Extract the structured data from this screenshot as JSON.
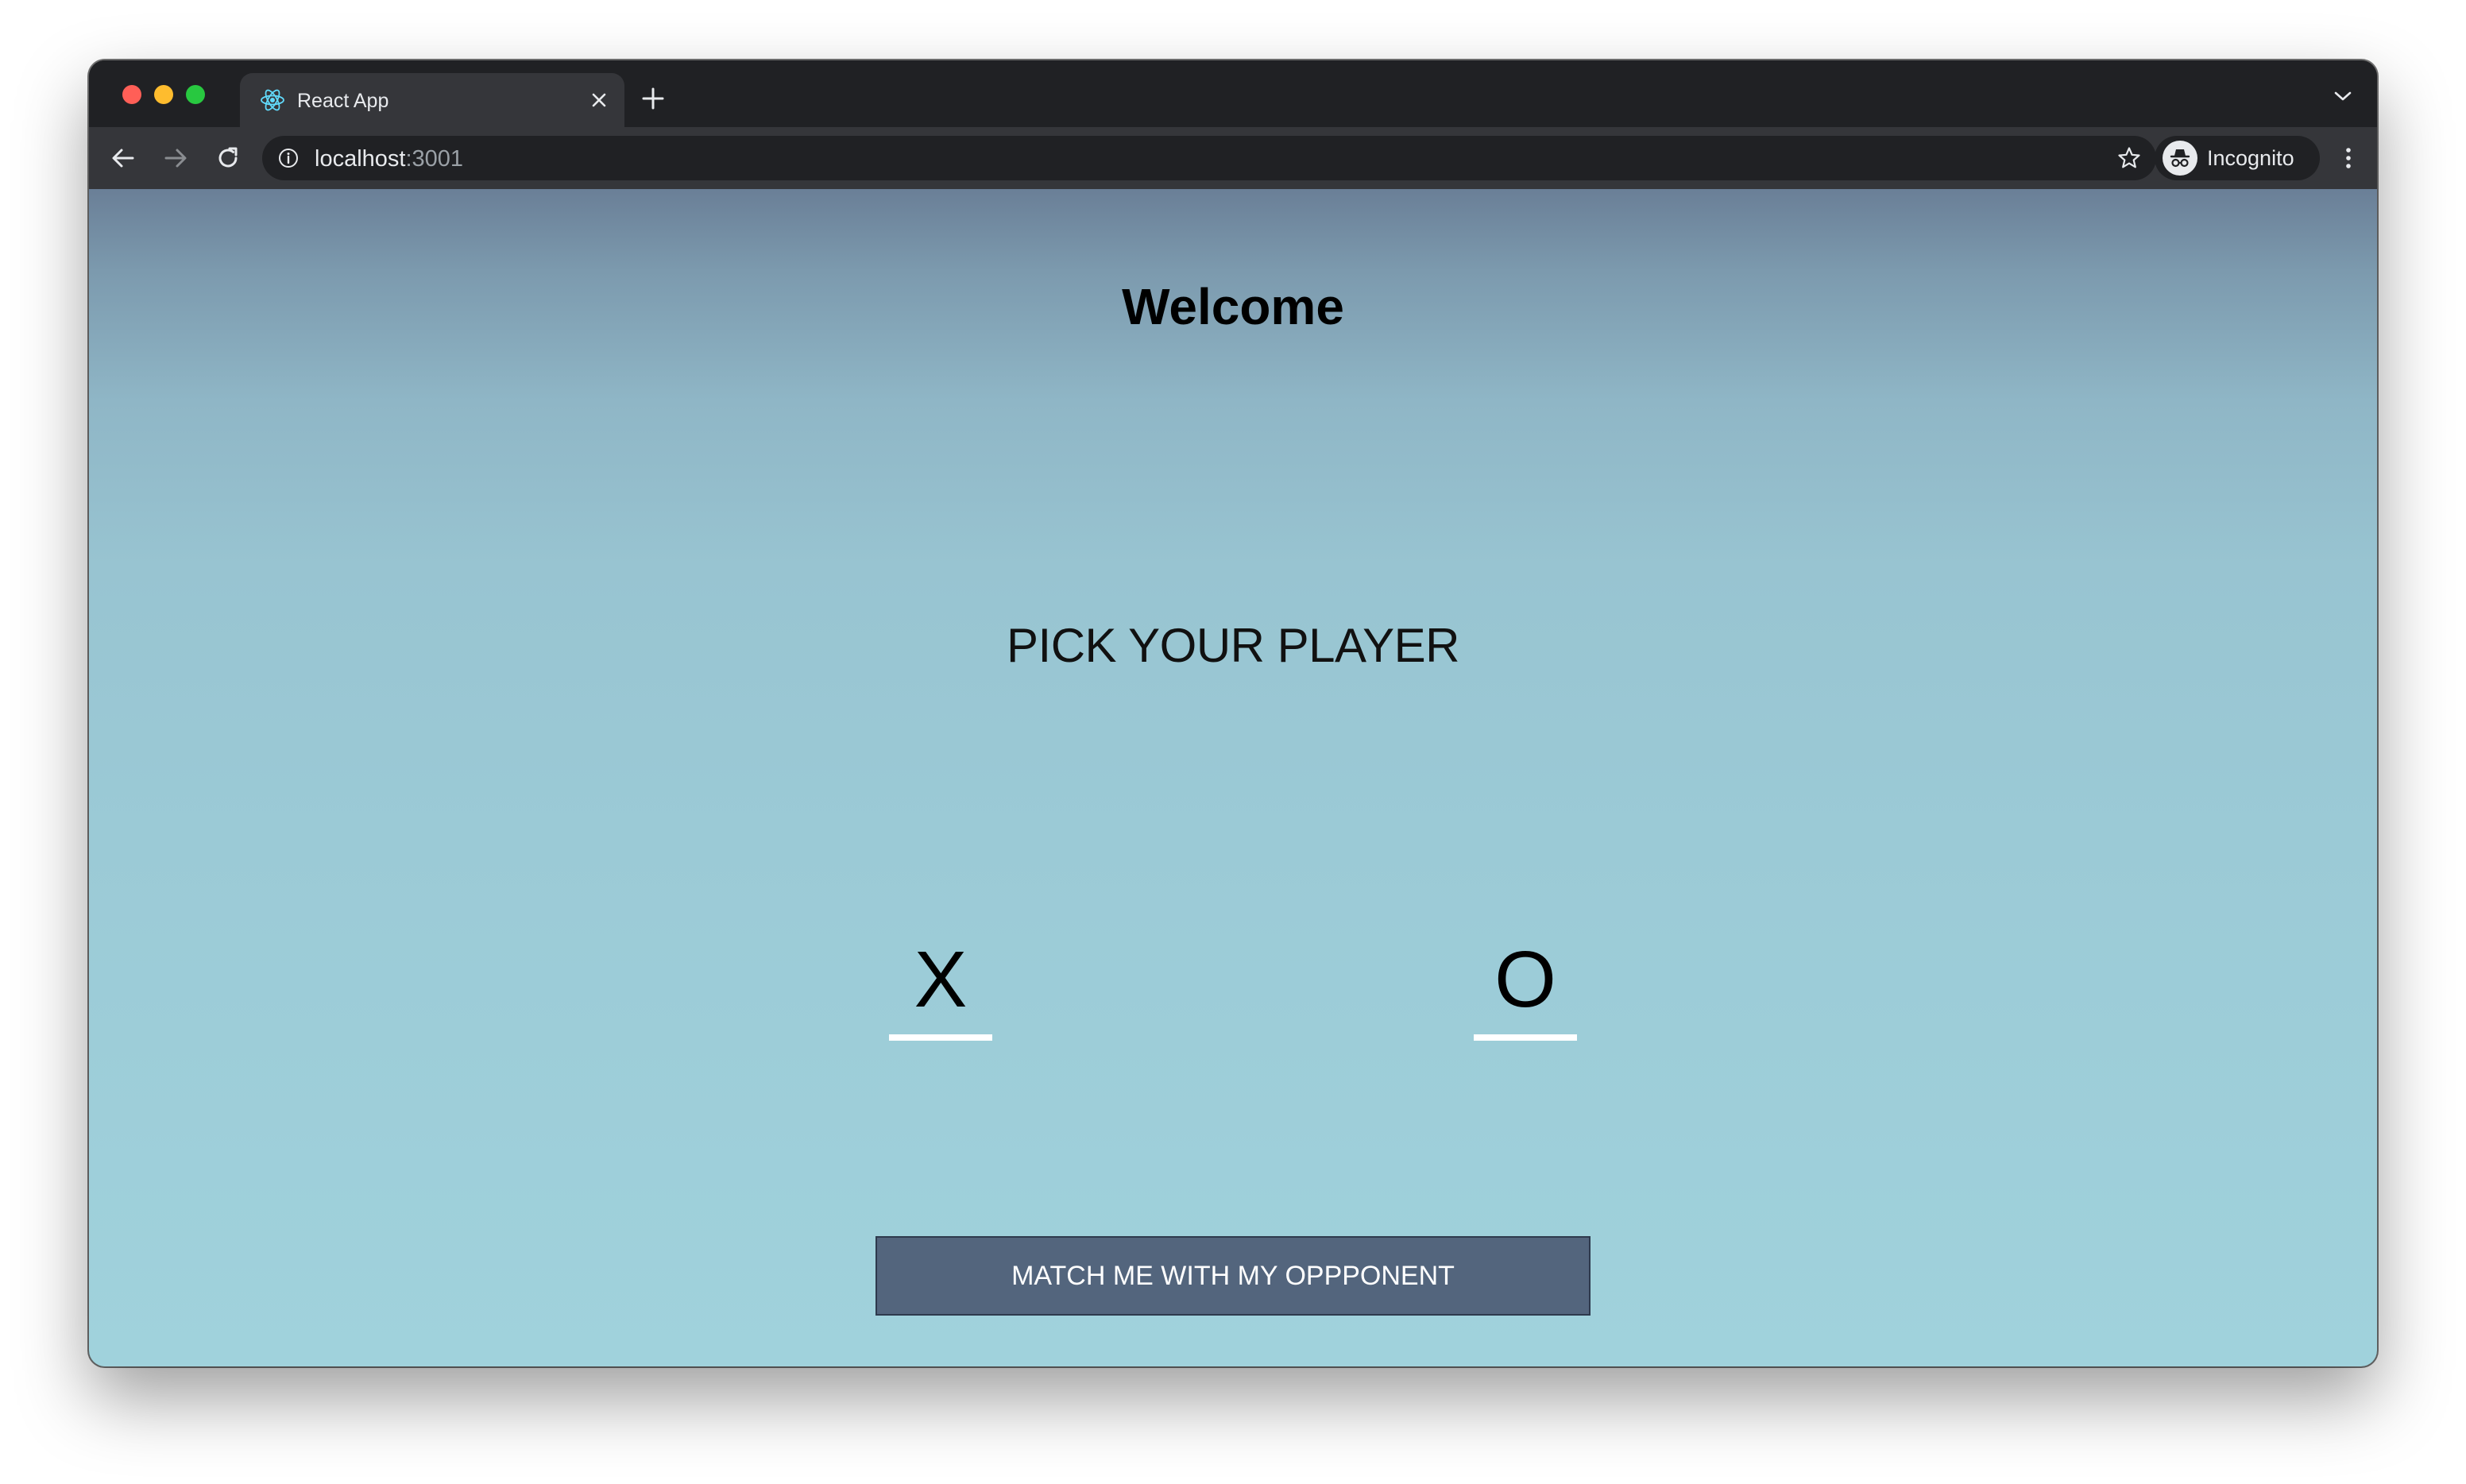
{
  "browser": {
    "tab": {
      "title": "React App"
    },
    "address_bar": {
      "host": "localhost",
      "port": ":3001"
    },
    "profile": {
      "label": "Incognito"
    }
  },
  "page": {
    "heading": "Welcome",
    "prompt": "PICK YOUR PLAYER",
    "players": [
      {
        "label": "X"
      },
      {
        "label": "O"
      }
    ],
    "match_button_label": "MATCH ME WITH MY OPPPONENT"
  },
  "colors": {
    "browser_frame": "#202124",
    "toolbar": "#35363a",
    "button_bg": "#53657d",
    "gradient_top": "#6a7f97",
    "gradient_bottom": "#a0d2dc",
    "underline": "#ffffff"
  },
  "icons": {
    "tab_favicon": "react-logo-icon",
    "tab_close": "close-icon",
    "new_tab": "plus-icon",
    "tab_list": "chevron-down-icon",
    "back": "arrow-left-icon",
    "forward": "arrow-right-icon",
    "reload": "reload-icon",
    "site_info": "info-icon",
    "bookmark": "star-icon",
    "incognito": "incognito-icon",
    "menu": "kebab-menu-icon"
  }
}
